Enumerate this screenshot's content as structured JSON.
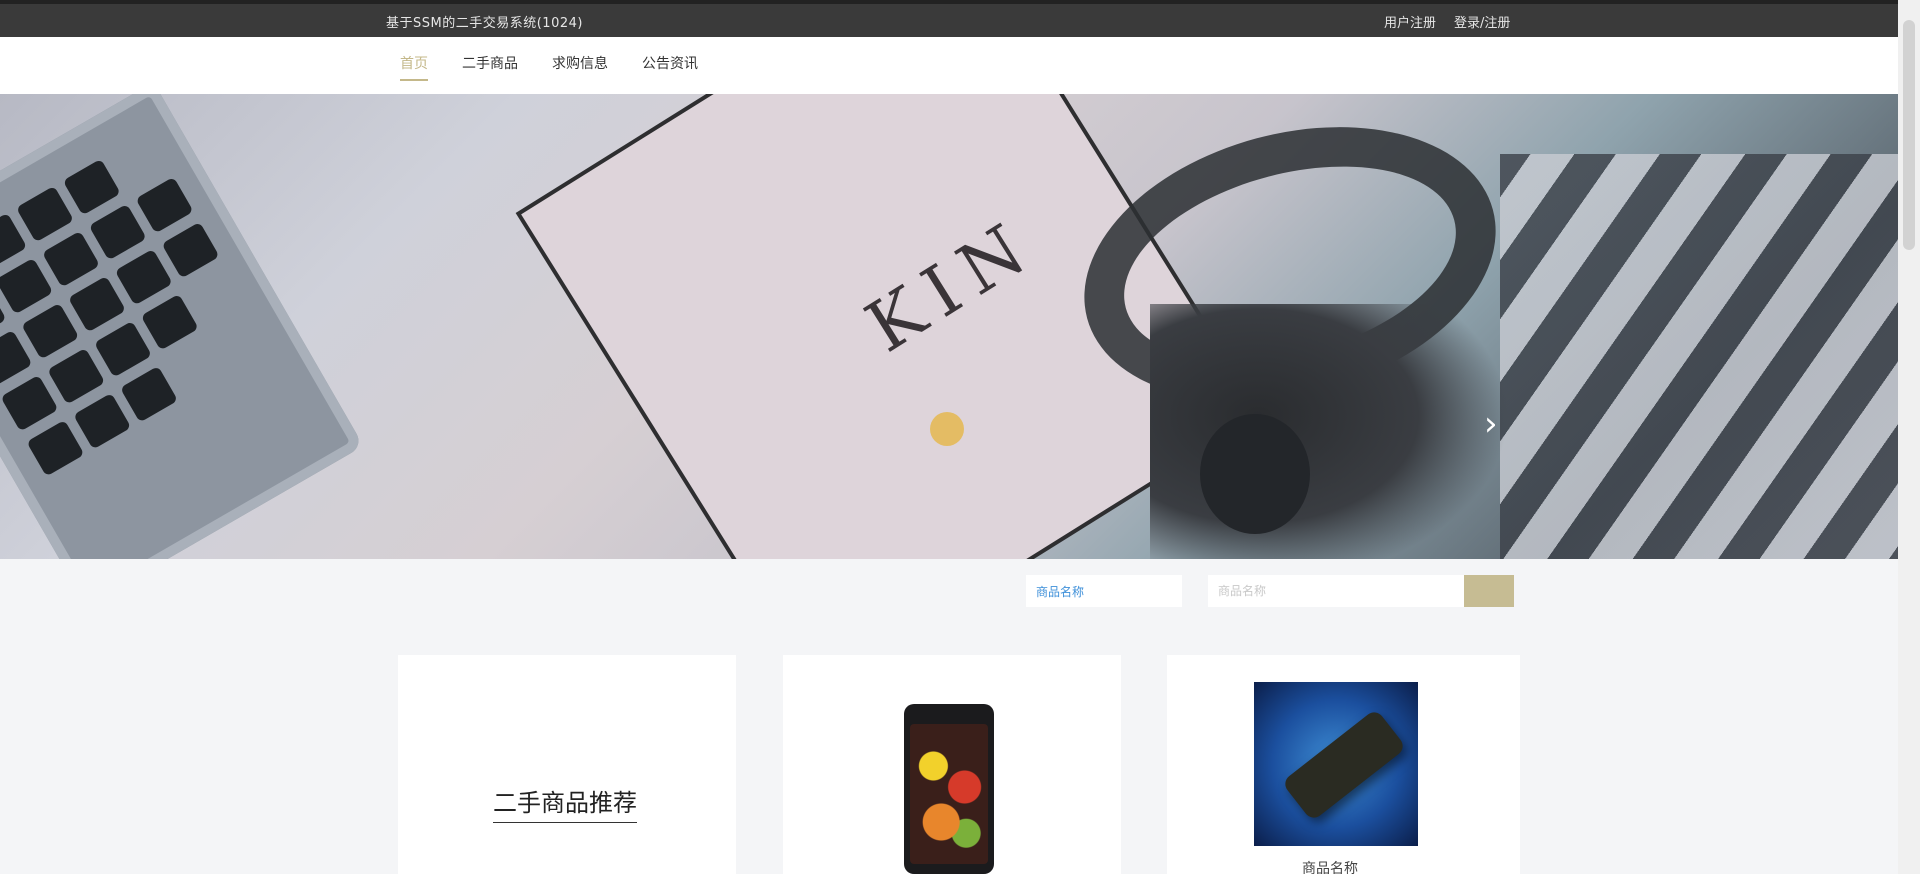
{
  "topbar": {
    "site_title": "基于SSM的二手交易系统(1024)",
    "links": [
      "用户注册",
      "登录/注册"
    ]
  },
  "nav": {
    "items": [
      {
        "label": "首页",
        "active": true
      },
      {
        "label": "二手商品",
        "active": false
      },
      {
        "label": "求购信息",
        "active": false
      },
      {
        "label": "公告资讯",
        "active": false
      }
    ]
  },
  "banner": {
    "text": "KIN",
    "next_icon": "chevron-right-icon"
  },
  "search": {
    "type_label": "商品名称",
    "placeholder": "商品名称",
    "button_icon": "search-icon"
  },
  "products": {
    "section_title": "二手商品推荐",
    "items": [
      {
        "name": "",
        "image": "phone"
      },
      {
        "name": "商品名称",
        "image": "remote-control"
      }
    ]
  },
  "colors": {
    "accent": "#c6bc93",
    "topbar": "#3a3a3a",
    "link_blue": "#3d8fd9"
  }
}
